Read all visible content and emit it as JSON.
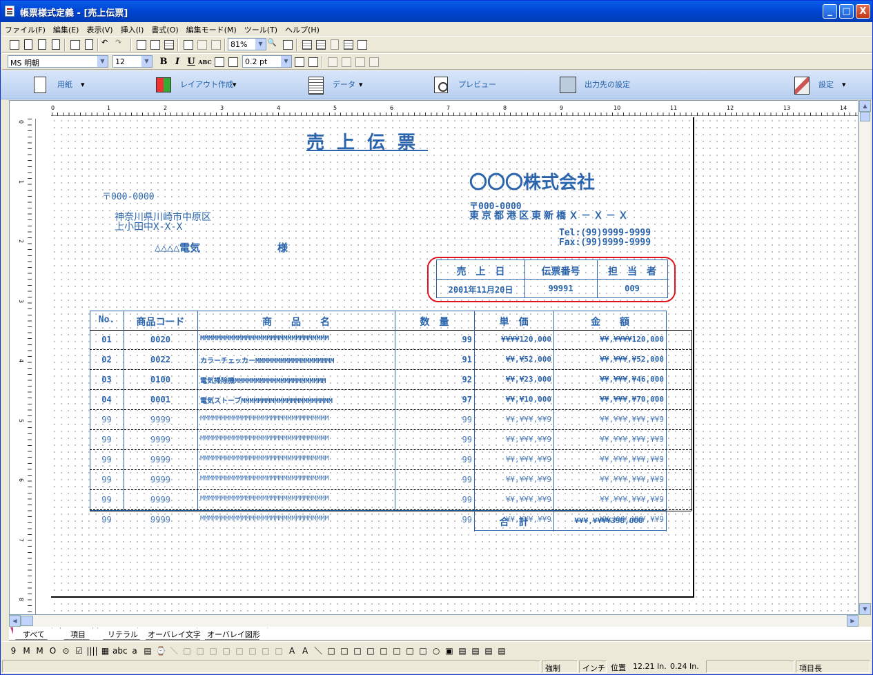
{
  "window": {
    "title": "帳票様式定義 - [売上伝票]",
    "buttons": {
      "minimize": "_",
      "maximize": "□",
      "close": "X"
    }
  },
  "menu": [
    "ファイル(F)",
    "編集(E)",
    "表示(V)",
    "挿入(I)",
    "書式(O)",
    "編集モード(M)",
    "ツール(T)",
    "ヘルプ(H)"
  ],
  "toolbar": {
    "zoom": "81%",
    "font": "MS 明朝",
    "font_size": "12",
    "line_width": "0.2 pt",
    "bold": "B",
    "italic": "I",
    "underline": "U",
    "abc": "ABC"
  },
  "ribbon": [
    {
      "icon": "paper-icon",
      "label": "用紙",
      "dropdown": true
    },
    {
      "icon": "layout-icon",
      "label": "レイアウト作成",
      "dropdown": true
    },
    {
      "icon": "data-icon",
      "label": "データ",
      "dropdown": true
    },
    {
      "icon": "preview-icon",
      "label": "プレビュー",
      "dropdown": false
    },
    {
      "icon": "output-icon",
      "label": "出力先の設定",
      "dropdown": false
    },
    {
      "icon": "settings-icon",
      "label": "設定",
      "dropdown": true
    }
  ],
  "ruler": {
    "h_numbers": [
      "0",
      "1",
      "2",
      "3",
      "4",
      "5",
      "6",
      "7",
      "8",
      "9",
      "10",
      "11",
      "12",
      "13",
      "14"
    ],
    "v_numbers": [
      "0",
      "1",
      "2",
      "3",
      "4",
      "5",
      "6",
      "7",
      "8"
    ]
  },
  "form": {
    "title": "売上伝票",
    "company": "〇〇〇株式会社",
    "company_zip": "〒000-0000",
    "company_address": "東京都港区東新橋Ｘ－Ｘ－Ｘ",
    "tel": "Tel:(99)9999-9999",
    "fax": "Fax:(99)9999-9999",
    "customer_zip": "〒000-0000",
    "customer_address1": "神奈川県川崎市中原区",
    "customer_address2": "上小田中X-X-X",
    "customer_name": "△△△△電気",
    "honorific": "様",
    "info_headers": [
      "売　上　日",
      "伝票番号",
      "担　当　者"
    ],
    "info_values": [
      "2001年11月20日",
      "99991",
      "009"
    ],
    "columns": [
      "No.",
      "商品コード",
      "商　　品　　名",
      "数　量",
      "単　価",
      "金　　額"
    ],
    "rows": [
      [
        "01",
        "0020",
        "MMMMMMMMMMMMMMMMMMMMMMMMMMMMMMM",
        "99",
        "¥¥¥¥120,000",
        "¥¥,¥¥¥¥120,000"
      ],
      [
        "02",
        "0022",
        "カラーチェッカーMMMMMMMMMMMMMMMMMMM",
        "91",
        "¥¥,¥52,000",
        "¥¥,¥¥¥,¥52,000"
      ],
      [
        "03",
        "0100",
        "電気掃除機MMMMMMMMMMMMMMMMMMMMMM",
        "92",
        "¥¥,¥23,000",
        "¥¥,¥¥¥,¥46,000"
      ],
      [
        "04",
        "0001",
        "電気ストーブMMMMMMMMMMMMMMMMMMMMMM",
        "97",
        "¥¥,¥10,000",
        "¥¥,¥¥¥,¥70,000"
      ],
      [
        "99",
        "9999",
        "MMMMMMMMMMMMMMMMMMMMMMMMMMMMMMM",
        "99",
        "¥¥,¥¥¥,¥¥9",
        "¥¥,¥¥¥,¥¥¥,¥¥9"
      ],
      [
        "99",
        "9999",
        "MMMMMMMMMMMMMMMMMMMMMMMMMMMMMMM",
        "99",
        "¥¥,¥¥¥,¥¥9",
        "¥¥,¥¥¥,¥¥¥,¥¥9"
      ],
      [
        "99",
        "9999",
        "MMMMMMMMMMMMMMMMMMMMMMMMMMMMMMM",
        "99",
        "¥¥,¥¥¥,¥¥9",
        "¥¥,¥¥¥,¥¥¥,¥¥9"
      ],
      [
        "99",
        "9999",
        "MMMMMMMMMMMMMMMMMMMMMMMMMMMMMMM",
        "99",
        "¥¥,¥¥¥,¥¥9",
        "¥¥,¥¥¥,¥¥¥,¥¥9"
      ],
      [
        "99",
        "9999",
        "MMMMMMMMMMMMMMMMMMMMMMMMMMMMMMM",
        "99",
        "¥¥,¥¥¥,¥¥9",
        "¥¥,¥¥¥,¥¥¥,¥¥9"
      ],
      [
        "99",
        "9999",
        "MMMMMMMMMMMMMMMMMMMMMMMMMMMMMMM",
        "99",
        "¥¥,¥¥¥,¥¥9",
        "¥¥,¥¥¥,¥¥¥,¥¥9"
      ]
    ],
    "total_label": "合　計",
    "total_value": "¥¥¥,¥¥¥¥398,000"
  },
  "tabs": [
    "すべて",
    "項目",
    "リテラル",
    "オーバレイ文字",
    "オーバレイ図形"
  ],
  "toolbox": [
    "9",
    "M",
    "M",
    "O",
    "⊙",
    "☑",
    "||||",
    "▦",
    "abc",
    "a",
    "▤",
    "⌚",
    "＼",
    "□",
    "□",
    "□",
    "□",
    "□",
    "□",
    "□",
    "□",
    "A",
    "A",
    "＼",
    "□",
    "□",
    "□",
    "□",
    "□",
    "□",
    "□",
    "□",
    "○",
    "▣",
    "▤",
    "▤",
    "▤",
    "▤"
  ],
  "status": {
    "mode": "強制",
    "unit": "インチ",
    "pos_label": "位置",
    "pos_x": "12.21 In.",
    "pos_y": "0.24 In.",
    "field_len": "項目長"
  },
  "colors": {
    "form_text": "#2A64AC",
    "highlight": "#E0141E"
  }
}
